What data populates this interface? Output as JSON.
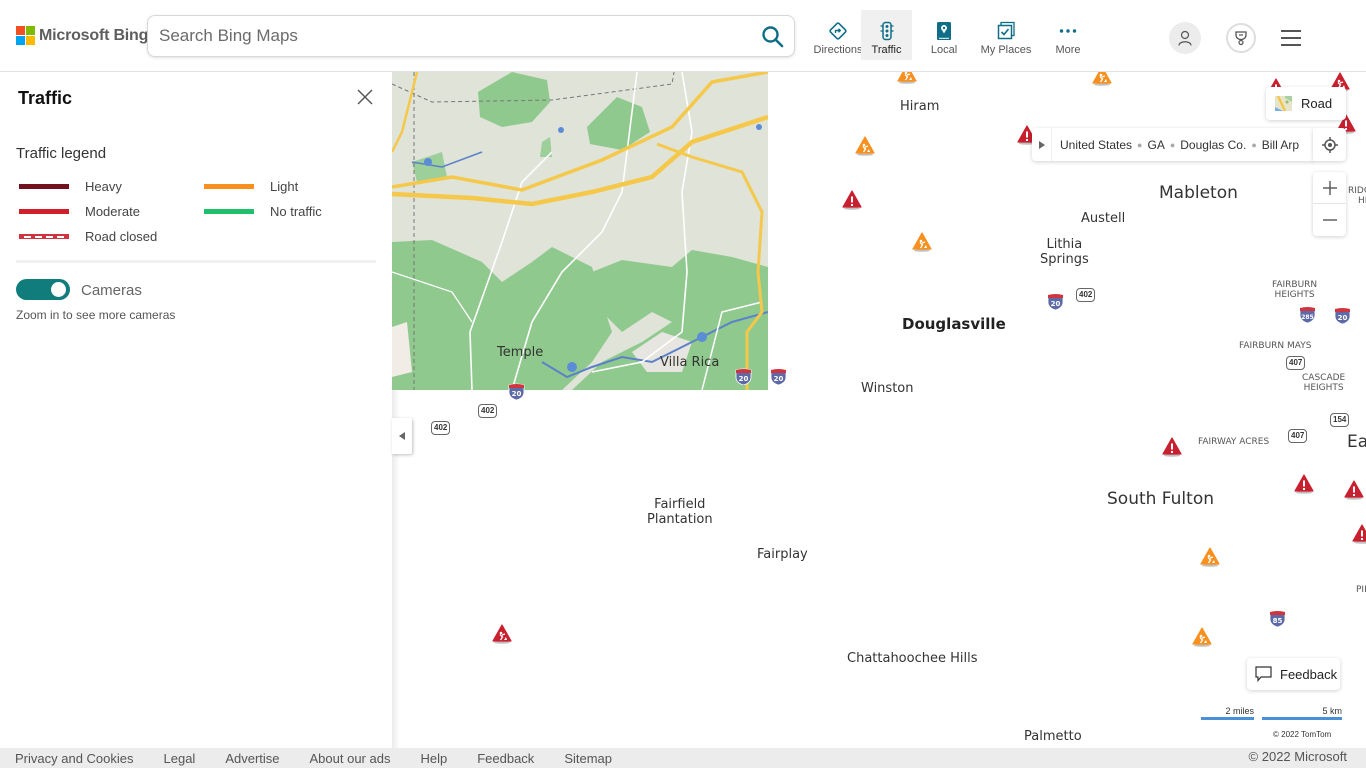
{
  "brand": {
    "name": "Microsoft Bing"
  },
  "search": {
    "placeholder": "Search Bing Maps",
    "value": ""
  },
  "nav": [
    {
      "label": "Directions",
      "icon": "directions-icon"
    },
    {
      "label": "Traffic",
      "icon": "traffic-light-icon",
      "active": true
    },
    {
      "label": "Local",
      "icon": "local-pin-icon"
    },
    {
      "label": "My Places",
      "icon": "my-places-icon"
    },
    {
      "label": "More",
      "icon": "more-dots-icon"
    }
  ],
  "panel": {
    "title": "Traffic",
    "legend_title": "Traffic legend",
    "legend": [
      {
        "label": "Heavy",
        "color": "#74111f"
      },
      {
        "label": "Moderate",
        "color": "#d21f2c"
      },
      {
        "label": "Road closed",
        "color": "#d1343f",
        "style": "dashed"
      },
      {
        "label": "Light",
        "color": "#f7901e"
      },
      {
        "label": "No traffic",
        "color": "#1fbf6b"
      }
    ],
    "cameras_toggle": {
      "label": "Cameras",
      "on": true,
      "color": "#107c7c"
    },
    "cameras_note": "Zoom in to see more cameras"
  },
  "map": {
    "style_button": "Road",
    "breadcrumb": [
      "United States",
      "GA",
      "Douglas Co.",
      "Bill Arp"
    ],
    "labels": {
      "hiram": "Hiram",
      "mableton": "Mableton",
      "austell": "Austell",
      "lithia_springs_1": "Lithia",
      "lithia_springs_2": "Springs",
      "douglasville": "Douglasville",
      "winston": "Winston",
      "temple": "Temple",
      "villa_rica": "Villa Rica",
      "fairburn_heights_1": "FAIRBURN",
      "fairburn_heights_2": "HEIGHTS",
      "fairburn_mays": "FAIRBURN MAYS",
      "cascade_heights_1": "CASCADE",
      "cascade_heights_2": "HEIGHTS",
      "fairway_acres": "FAIRWAY ACRES",
      "ridge_heights_1": "RIDGE",
      "ridge_heights_2": "HE",
      "east": "Eas",
      "south_fulton": "South Fulton",
      "fairfield_1": "Fairfield",
      "fairfield_2": "Plantation",
      "fairplay": "Fairplay",
      "chattahoochee_hills": "Chattahoochee Hills",
      "palmetto": "Palmetto",
      "pi": "PII"
    },
    "shields": {
      "i20": "20",
      "i285": "285",
      "i85": "85",
      "s402": "402",
      "s407": "407",
      "s154": "154"
    },
    "scale": {
      "miles": "2 miles",
      "km": "5 km"
    },
    "attribution": "© 2022 TomTom",
    "feedback": "Feedback",
    "colors": {
      "incident_red": "#c8202f",
      "construction_orange": "#f7901e",
      "interstate": "#5e6aa8"
    }
  },
  "footer": {
    "links": [
      "Privacy and Cookies",
      "Legal",
      "Advertise",
      "About our ads",
      "Help",
      "Feedback",
      "Sitemap"
    ],
    "copyright": "© 2022 Microsoft"
  }
}
